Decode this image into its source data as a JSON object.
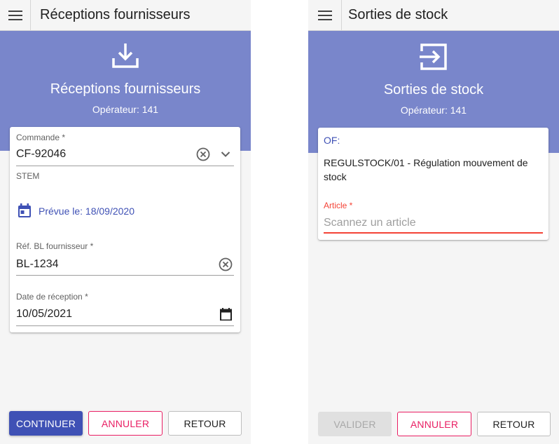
{
  "left_screen": {
    "appbar_title": "Réceptions fournisseurs",
    "banner_title": "Réceptions fournisseurs",
    "operator_text": "Opérateur: 141",
    "order": {
      "label": "Commande *",
      "value": "CF-92046",
      "supplier": "STEM"
    },
    "planned_date": "Prévue le: 18/09/2020",
    "supplier_ref": {
      "label": "Réf. BL fournisseur *",
      "value": "BL-1234"
    },
    "reception_date": {
      "label": "Date de réception *",
      "value": "10/05/2021"
    },
    "buttons": {
      "continue": "CONTINUER",
      "cancel": "ANNULER",
      "back": "RETOUR"
    }
  },
  "right_screen": {
    "appbar_title": "Sorties de stock",
    "banner_title": "Sorties de stock",
    "operator_text": "Opérateur: 141",
    "of_label": "OF:",
    "of_value": "REGULSTOCK/01 - Régulation mouvement de stock",
    "article": {
      "label": "Article *",
      "placeholder": "Scannez un article"
    },
    "buttons": {
      "validate": "VALIDER",
      "cancel": "ANNULER",
      "back": "RETOUR"
    }
  },
  "colors": {
    "banner": "#7986cb",
    "primary": "#3f51b5",
    "accent_pink": "#e91e63",
    "error_red": "#f44336",
    "app_background": "#f5f5f5"
  },
  "icons": {
    "menu": "hamburger-icon",
    "reception_banner": "download-tray-icon",
    "exit_banner": "exit-arrow-icon",
    "clear": "clear-circle-icon",
    "dropdown": "chevron-down-icon",
    "calendar": "calendar-icon"
  }
}
